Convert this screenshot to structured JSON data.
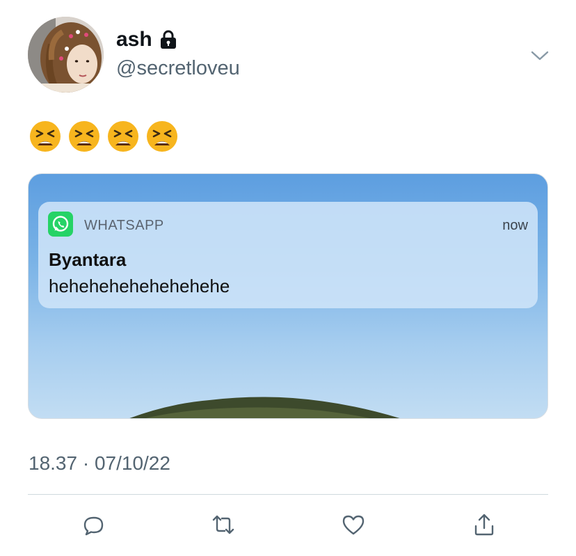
{
  "tweet": {
    "display_name": "ash",
    "handle": "@secretloveu",
    "emojis": [
      "tired-face-emoji",
      "tired-face-emoji",
      "tired-face-emoji",
      "tired-face-emoji"
    ],
    "timestamp": "18.37 · 07/10/22"
  },
  "notification": {
    "app_name": "WHATSAPP",
    "time": "now",
    "sender": "Byantara",
    "message": "hehehehehehehehehe"
  },
  "icons": {
    "lock": "lock-icon",
    "menu": "chevron-down-icon",
    "whatsapp": "whatsapp-icon",
    "reply": "reply-icon",
    "retweet": "retweet-icon",
    "like": "heart-icon",
    "share": "share-icon"
  },
  "colors": {
    "secondary_text": "#536471",
    "whatsapp_green": "#25d366",
    "sky": "#79b2e6"
  }
}
